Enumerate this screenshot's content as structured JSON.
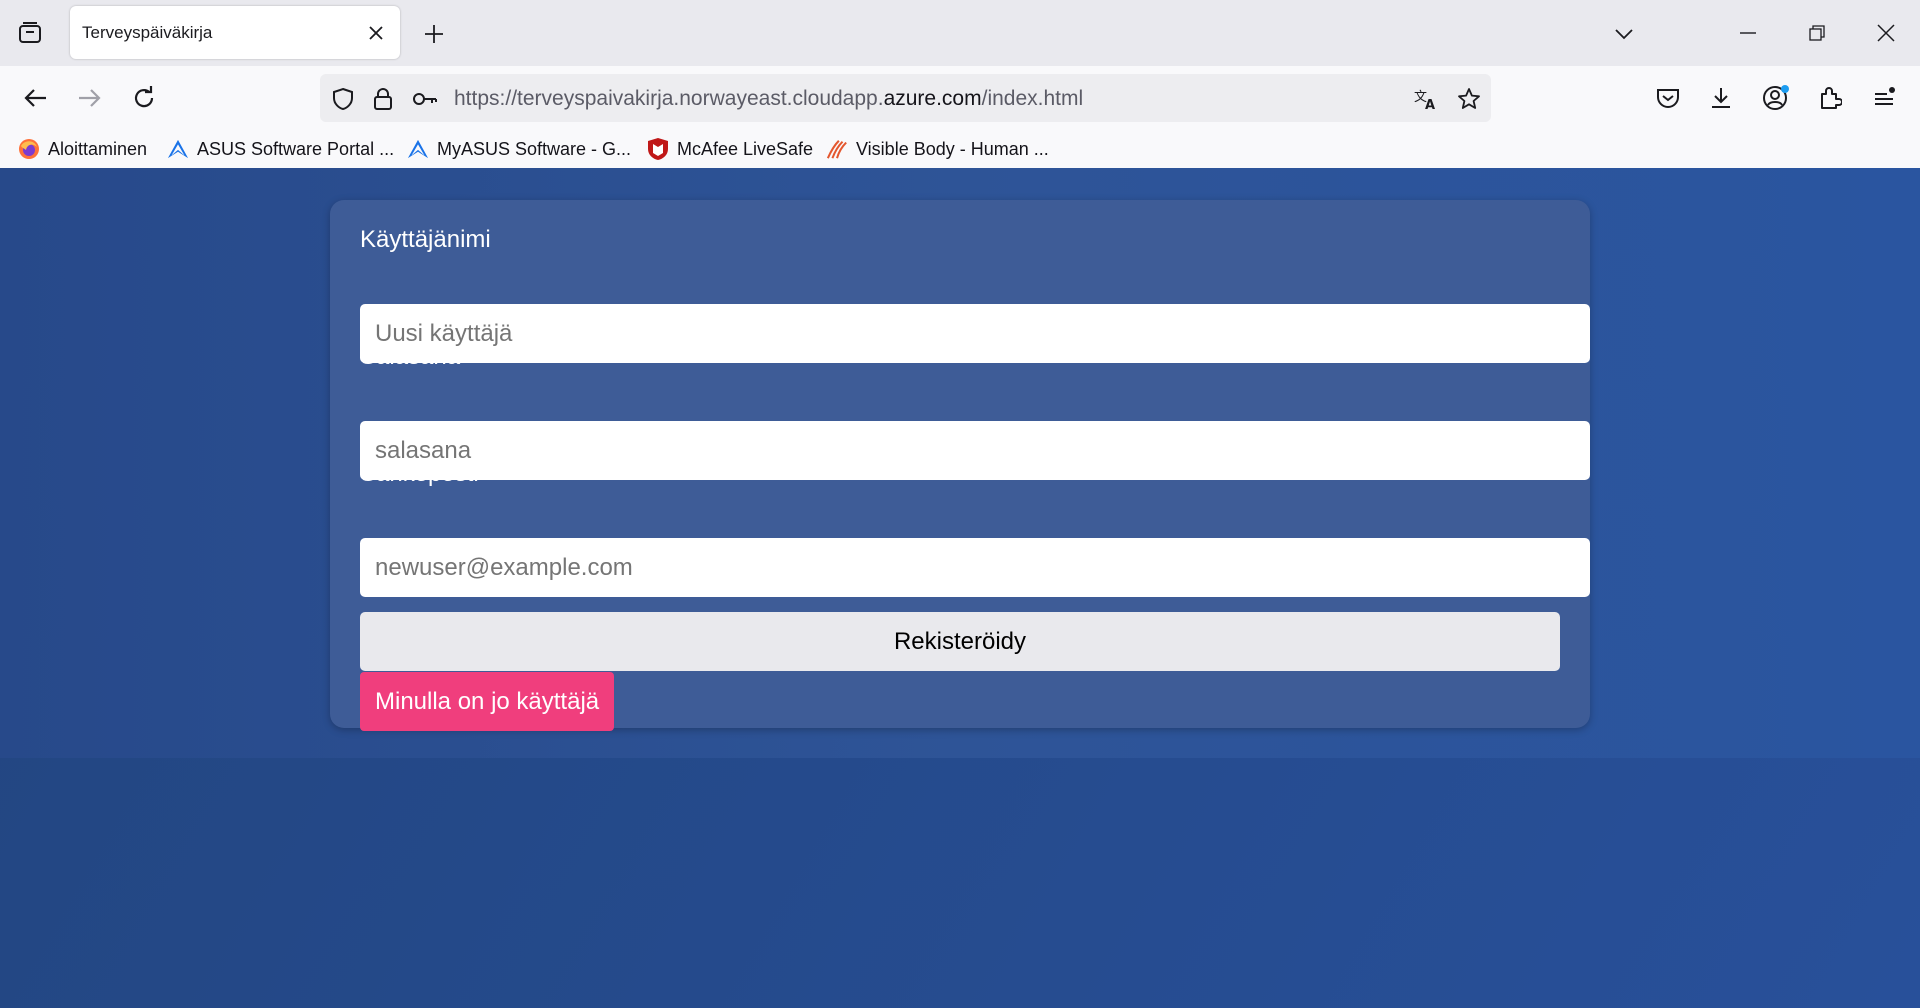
{
  "browser": {
    "tab": {
      "title": "Terveyspäiväkirja"
    },
    "url": {
      "prefix": "https://terveyspaivakirja.norwayeast.cloudapp.",
      "host": "azure.com",
      "path": "/index.html"
    },
    "bookmarks": [
      {
        "label": "Aloittaminen",
        "icon": "firefox-icon"
      },
      {
        "label": "ASUS Software Portal ...",
        "icon": "asus-logo-icon"
      },
      {
        "label": "MyASUS Software - G...",
        "icon": "asus-logo-icon"
      },
      {
        "label": "McAfee LiveSafe",
        "icon": "mcafee-shield-icon"
      },
      {
        "label": "Visible Body - Human ...",
        "icon": "visible-body-icon"
      }
    ],
    "colors": {
      "tabbar": "#e9e9ee",
      "navbar": "#f9f9fb"
    }
  },
  "form": {
    "username": {
      "label": "Käyttäjänimi",
      "placeholder": "Uusi käyttäjä"
    },
    "password": {
      "label": "Salasana",
      "placeholder": "salasana"
    },
    "email": {
      "label": "Sähköposti",
      "placeholder": "newuser@example.com"
    },
    "register_label": "Rekisteröidy",
    "have_account_label": "Minulla on jo käyttäjä"
  },
  "colors": {
    "page_bg": "#23478a",
    "card_bg": "#3e5c97",
    "accent_pink": "#f03e7d"
  }
}
